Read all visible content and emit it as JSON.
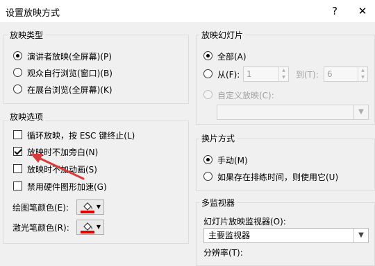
{
  "window": {
    "title": "设置放映方式",
    "help": "?",
    "close": "✕"
  },
  "show_type": {
    "title": "放映类型",
    "options": [
      {
        "label": "演讲者放映(全屏幕)(P)",
        "checked": true
      },
      {
        "label": "观众自行浏览(窗口)(B)",
        "checked": false
      },
      {
        "label": "在展台浏览(全屏幕)(K)",
        "checked": false
      }
    ]
  },
  "show_options": {
    "title": "放映选项",
    "options": [
      {
        "label": "循环放映，按 ESC 键终止(L)",
        "checked": false
      },
      {
        "label": "放映时不加旁白(N)",
        "checked": true
      },
      {
        "label": "放映时不加动画(S)",
        "checked": false
      },
      {
        "label": "禁用硬件图形加速(G)",
        "checked": false
      }
    ],
    "pen_color_label": "绘图笔颜色(E):",
    "laser_color_label": "激光笔颜色(R):",
    "pen_color": "#e00000",
    "laser_color": "#e00000"
  },
  "slides": {
    "title": "放映幻灯片",
    "all_label": "全部(A)",
    "from_label": "从(F):",
    "from_value": "1",
    "to_label": "到(T):",
    "to_value": "6",
    "custom_label": "自定义放映(C):",
    "custom_value": ""
  },
  "advance": {
    "title": "换片方式",
    "manual_label": "手动(M)",
    "timings_label": "如果存在排练时间，则使用它(U)"
  },
  "monitors": {
    "title": "多监视器",
    "monitor_label": "幻灯片放映监视器(O):",
    "monitor_value": "主要监视器",
    "resolution_label": "分辨率(T):"
  },
  "annotation": {
    "arrow_color": "#d93a3a"
  }
}
